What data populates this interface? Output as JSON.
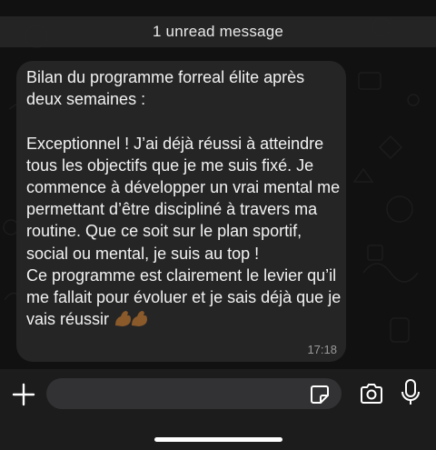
{
  "unread_banner": {
    "text": "1 unread message"
  },
  "message": {
    "text": "Bilan du programme forreal élite après deux semaines :\n\nExceptionnel ! J’ai déjà réussi à atteindre tous les objectifs que je me suis fixé. Je commence à développer un vrai mental me permettant d’être discipliné à travers ma routine. Que ce soit sur le plan sportif, social ou mental, je suis au top !\nCe programme est clairement le levier qu’il me fallait pour évoluer et je sais déjà que je vais réussir",
    "emoji": "💪🏾💪🏾",
    "time": "17:18"
  },
  "composer": {
    "icons": [
      "plus-icon",
      "sticker-icon",
      "camera-icon",
      "microphone-icon"
    ]
  },
  "colors": {
    "bubble": "#252526",
    "background": "#111111",
    "composer_bar": "#1c1c1d",
    "input_field": "#323234"
  }
}
